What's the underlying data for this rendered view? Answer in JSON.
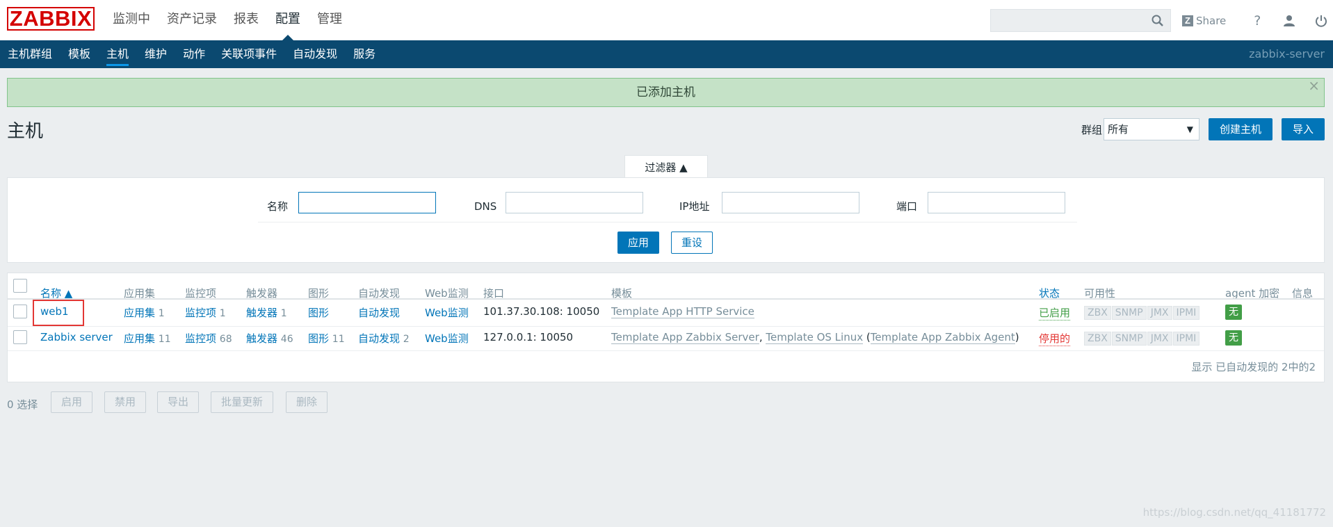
{
  "app": {
    "logo": "ZABBIX"
  },
  "topmenu": [
    {
      "label": "监测中",
      "active": false
    },
    {
      "label": "资产记录",
      "active": false
    },
    {
      "label": "报表",
      "active": false
    },
    {
      "label": "配置",
      "active": true
    },
    {
      "label": "管理",
      "active": false
    }
  ],
  "toolbar": {
    "search_placeholder": "",
    "share_label": "Share",
    "help": "?"
  },
  "subnav": {
    "items": [
      {
        "label": "主机群组",
        "active": false
      },
      {
        "label": "模板",
        "active": false
      },
      {
        "label": "主机",
        "active": true
      },
      {
        "label": "维护",
        "active": false
      },
      {
        "label": "动作",
        "active": false
      },
      {
        "label": "关联项事件",
        "active": false
      },
      {
        "label": "自动发现",
        "active": false
      },
      {
        "label": "服务",
        "active": false
      }
    ],
    "server": "zabbix-server"
  },
  "message": {
    "text": "已添加主机",
    "close": "×"
  },
  "page": {
    "title": "主机",
    "group_label": "群组",
    "group_value": "所有",
    "create_button": "创建主机",
    "import_button": "导入"
  },
  "filter": {
    "tab_label": "过滤器 ▲",
    "name_label": "名称",
    "dns_label": "DNS",
    "ip_label": "IP地址",
    "port_label": "端口",
    "apply": "应用",
    "reset": "重设"
  },
  "table": {
    "headers": [
      "名称 ▲",
      "应用集",
      "监控项",
      "触发器",
      "图形",
      "自动发现",
      "Web监测",
      "接口",
      "模板",
      "状态",
      "可用性",
      "agent 加密",
      "信息"
    ],
    "rows": [
      {
        "name": "web1",
        "apps": "应用集",
        "apps_n": "1",
        "items": "监控项",
        "items_n": "1",
        "triggers": "触发器",
        "triggers_n": "1",
        "graphs": "图形",
        "graphs_n": "",
        "discovery": "自动发现",
        "discovery_n": "",
        "web": "Web监测",
        "interface": "101.37.30.108: 10050",
        "templates": "Template App HTTP Service",
        "status": "已启用",
        "avail": [
          "ZBX",
          "SNMP",
          "JMX",
          "IPMI"
        ],
        "encryption": "无"
      },
      {
        "name": "Zabbix server",
        "apps": "应用集",
        "apps_n": "11",
        "items": "监控项",
        "items_n": "68",
        "triggers": "触发器",
        "triggers_n": "46",
        "graphs": "图形",
        "graphs_n": "11",
        "discovery": "自动发现",
        "discovery_n": "2",
        "web": "Web监测",
        "interface": "127.0.0.1: 10050",
        "template_a": "Template App Zabbix Server",
        "template_b": "Template OS Linux",
        "template_c": "Template App Zabbix Agent",
        "status": "停用的",
        "avail": [
          "ZBX",
          "SNMP",
          "JMX",
          "IPMI"
        ],
        "encryption": "无"
      }
    ],
    "footer": "显示 已自动发现的 2中的2"
  },
  "actions": {
    "selected": "0 选择",
    "enable": "启用",
    "disable": "禁用",
    "export": "导出",
    "mass_update": "批量更新",
    "delete": "删除"
  },
  "watermark": "https://blog.csdn.net/qq_41181772"
}
